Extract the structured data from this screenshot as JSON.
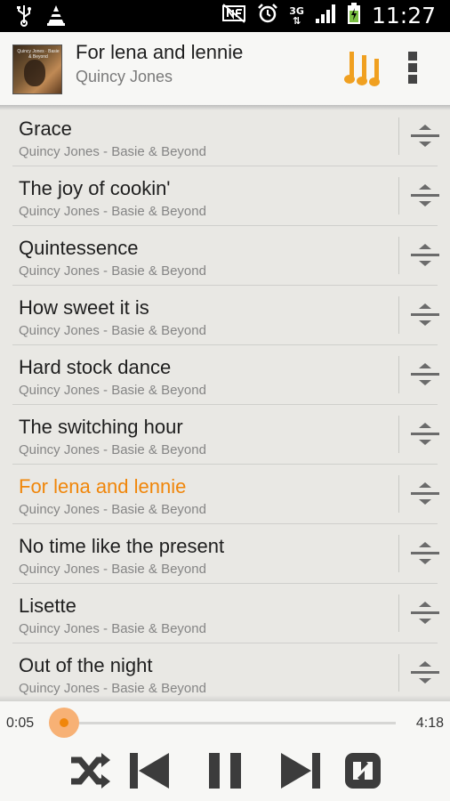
{
  "status_bar": {
    "time": "11:27",
    "network": "3G",
    "icons": [
      "usb-icon",
      "vlc-icon",
      "nfc-icon",
      "alarm-icon",
      "signal-icon",
      "battery-charging-icon"
    ]
  },
  "now_playing": {
    "title": "For lena and lennie",
    "artist": "Quincy Jones",
    "album_art_text": "Quincy Jones · Basie & Beyond"
  },
  "tracks": [
    {
      "title": "Grace",
      "subtitle": "Quincy Jones - Basie & Beyond",
      "active": false
    },
    {
      "title": "The joy of cookin'",
      "subtitle": "Quincy Jones - Basie & Beyond",
      "active": false
    },
    {
      "title": "Quintessence",
      "subtitle": "Quincy Jones - Basie & Beyond",
      "active": false
    },
    {
      "title": "How sweet it is",
      "subtitle": "Quincy Jones - Basie & Beyond",
      "active": false
    },
    {
      "title": "Hard stock dance",
      "subtitle": "Quincy Jones - Basie & Beyond",
      "active": false
    },
    {
      "title": "The switching hour",
      "subtitle": "Quincy Jones - Basie & Beyond",
      "active": false
    },
    {
      "title": "For lena and lennie",
      "subtitle": "Quincy Jones - Basie & Beyond",
      "active": true
    },
    {
      "title": "No time like the present",
      "subtitle": "Quincy Jones - Basie & Beyond",
      "active": false
    },
    {
      "title": "Lisette",
      "subtitle": "Quincy Jones - Basie & Beyond",
      "active": false
    },
    {
      "title": "Out of the night",
      "subtitle": "Quincy Jones - Basie & Beyond",
      "active": false
    }
  ],
  "player": {
    "elapsed": "0:05",
    "total": "4:18",
    "progress_fraction": 0.02,
    "controls": [
      "shuffle-icon",
      "previous-icon",
      "pause-icon",
      "next-icon",
      "repeat-icon"
    ]
  },
  "colors": {
    "accent": "#f0860a",
    "text_primary": "#1e1e1e",
    "text_secondary": "#858585",
    "background": "#e9e8e4",
    "controls": "#3c3c3c"
  }
}
